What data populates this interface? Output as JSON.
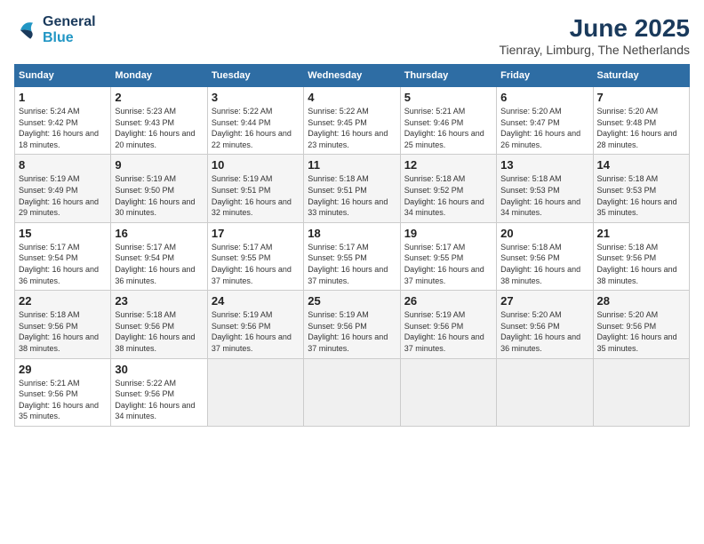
{
  "logo": {
    "line1": "General",
    "line2": "Blue"
  },
  "title": "June 2025",
  "location": "Tienray, Limburg, The Netherlands",
  "weekdays": [
    "Sunday",
    "Monday",
    "Tuesday",
    "Wednesday",
    "Thursday",
    "Friday",
    "Saturday"
  ],
  "weeks": [
    [
      {
        "day": "1",
        "sunrise": "5:24 AM",
        "sunset": "9:42 PM",
        "daylight": "16 hours and 18 minutes."
      },
      {
        "day": "2",
        "sunrise": "5:23 AM",
        "sunset": "9:43 PM",
        "daylight": "16 hours and 20 minutes."
      },
      {
        "day": "3",
        "sunrise": "5:22 AM",
        "sunset": "9:44 PM",
        "daylight": "16 hours and 22 minutes."
      },
      {
        "day": "4",
        "sunrise": "5:22 AM",
        "sunset": "9:45 PM",
        "daylight": "16 hours and 23 minutes."
      },
      {
        "day": "5",
        "sunrise": "5:21 AM",
        "sunset": "9:46 PM",
        "daylight": "16 hours and 25 minutes."
      },
      {
        "day": "6",
        "sunrise": "5:20 AM",
        "sunset": "9:47 PM",
        "daylight": "16 hours and 26 minutes."
      },
      {
        "day": "7",
        "sunrise": "5:20 AM",
        "sunset": "9:48 PM",
        "daylight": "16 hours and 28 minutes."
      }
    ],
    [
      {
        "day": "8",
        "sunrise": "5:19 AM",
        "sunset": "9:49 PM",
        "daylight": "16 hours and 29 minutes."
      },
      {
        "day": "9",
        "sunrise": "5:19 AM",
        "sunset": "9:50 PM",
        "daylight": "16 hours and 30 minutes."
      },
      {
        "day": "10",
        "sunrise": "5:19 AM",
        "sunset": "9:51 PM",
        "daylight": "16 hours and 32 minutes."
      },
      {
        "day": "11",
        "sunrise": "5:18 AM",
        "sunset": "9:51 PM",
        "daylight": "16 hours and 33 minutes."
      },
      {
        "day": "12",
        "sunrise": "5:18 AM",
        "sunset": "9:52 PM",
        "daylight": "16 hours and 34 minutes."
      },
      {
        "day": "13",
        "sunrise": "5:18 AM",
        "sunset": "9:53 PM",
        "daylight": "16 hours and 34 minutes."
      },
      {
        "day": "14",
        "sunrise": "5:18 AM",
        "sunset": "9:53 PM",
        "daylight": "16 hours and 35 minutes."
      }
    ],
    [
      {
        "day": "15",
        "sunrise": "5:17 AM",
        "sunset": "9:54 PM",
        "daylight": "16 hours and 36 minutes."
      },
      {
        "day": "16",
        "sunrise": "5:17 AM",
        "sunset": "9:54 PM",
        "daylight": "16 hours and 36 minutes."
      },
      {
        "day": "17",
        "sunrise": "5:17 AM",
        "sunset": "9:55 PM",
        "daylight": "16 hours and 37 minutes."
      },
      {
        "day": "18",
        "sunrise": "5:17 AM",
        "sunset": "9:55 PM",
        "daylight": "16 hours and 37 minutes."
      },
      {
        "day": "19",
        "sunrise": "5:17 AM",
        "sunset": "9:55 PM",
        "daylight": "16 hours and 37 minutes."
      },
      {
        "day": "20",
        "sunrise": "5:18 AM",
        "sunset": "9:56 PM",
        "daylight": "16 hours and 38 minutes."
      },
      {
        "day": "21",
        "sunrise": "5:18 AM",
        "sunset": "9:56 PM",
        "daylight": "16 hours and 38 minutes."
      }
    ],
    [
      {
        "day": "22",
        "sunrise": "5:18 AM",
        "sunset": "9:56 PM",
        "daylight": "16 hours and 38 minutes."
      },
      {
        "day": "23",
        "sunrise": "5:18 AM",
        "sunset": "9:56 PM",
        "daylight": "16 hours and 38 minutes."
      },
      {
        "day": "24",
        "sunrise": "5:19 AM",
        "sunset": "9:56 PM",
        "daylight": "16 hours and 37 minutes."
      },
      {
        "day": "25",
        "sunrise": "5:19 AM",
        "sunset": "9:56 PM",
        "daylight": "16 hours and 37 minutes."
      },
      {
        "day": "26",
        "sunrise": "5:19 AM",
        "sunset": "9:56 PM",
        "daylight": "16 hours and 37 minutes."
      },
      {
        "day": "27",
        "sunrise": "5:20 AM",
        "sunset": "9:56 PM",
        "daylight": "16 hours and 36 minutes."
      },
      {
        "day": "28",
        "sunrise": "5:20 AM",
        "sunset": "9:56 PM",
        "daylight": "16 hours and 35 minutes."
      }
    ],
    [
      {
        "day": "29",
        "sunrise": "5:21 AM",
        "sunset": "9:56 PM",
        "daylight": "16 hours and 35 minutes."
      },
      {
        "day": "30",
        "sunrise": "5:22 AM",
        "sunset": "9:56 PM",
        "daylight": "16 hours and 34 minutes."
      },
      null,
      null,
      null,
      null,
      null
    ]
  ]
}
